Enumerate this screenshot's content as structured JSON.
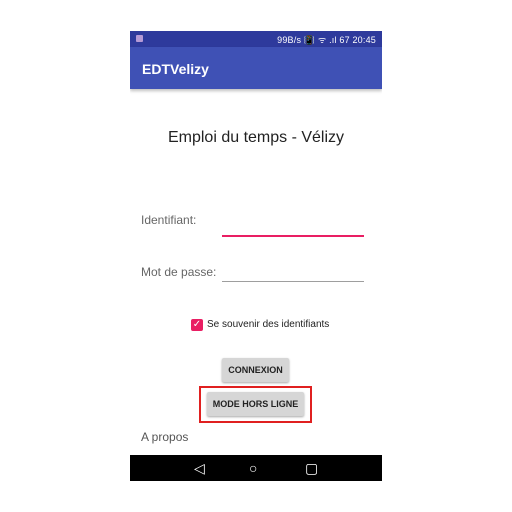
{
  "status_bar": {
    "right_text": "99B/s 📳 ᯤ .ıl 67 20:45"
  },
  "app_bar": {
    "title": "EDTVelizy"
  },
  "screen": {
    "title": "Emploi du temps - Vélizy",
    "identifiant_label": "Identifiant:",
    "identifiant_value": "",
    "password_label": "Mot de passe:",
    "password_value": "",
    "remember_label": "Se souvenir des identifiants",
    "remember_checked": true,
    "connexion_label": "CONNEXION",
    "offline_label": "MODE HORS LIGNE",
    "about_label": "A propos"
  },
  "nav": {
    "back_icon": "◁",
    "home_icon": "○",
    "recents_icon": "▢"
  },
  "colors": {
    "primary": "#3f51b5",
    "primary_dark": "#2e3a9c",
    "accent": "#e91e63",
    "highlight": "#e02020"
  }
}
